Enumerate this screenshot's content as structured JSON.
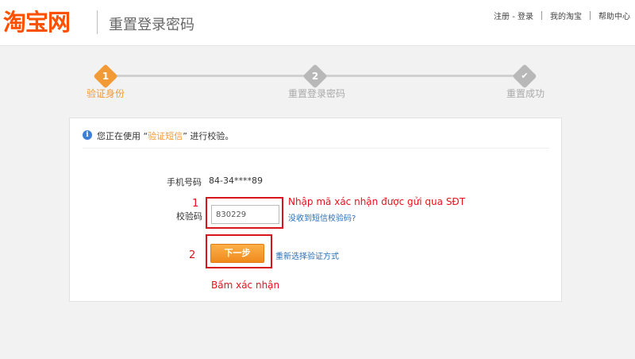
{
  "header": {
    "logo_text": "淘宝网",
    "page_title": "重置登录密码",
    "links": [
      "注册 - 登录",
      "我的淘宝",
      "帮助中心"
    ]
  },
  "steps": [
    {
      "number": "1",
      "label": "验证身份",
      "state": "active"
    },
    {
      "number": "2",
      "label": "重置登录密码",
      "state": "pending"
    },
    {
      "number": "✔",
      "label": "重置成功",
      "state": "pending"
    }
  ],
  "info": {
    "prefix": "您正在使用 “",
    "method": "验证短信",
    "suffix": "” 进行校验。"
  },
  "form": {
    "phone_label": "手机号码",
    "phone_value": "84-34****89",
    "code_label": "校验码",
    "code_value": "830229",
    "resend_link": "没收到短信校验码?",
    "next_button": "下一步",
    "other_method_link": "重新选择验证方式"
  },
  "annotations": {
    "num1": "1",
    "num2": "2",
    "text1": "Nhập mã xác nhận được gửi qua SĐT",
    "text2": "Bấm xác nhận"
  },
  "colors": {
    "brand": "#ff5000",
    "accent": "#f29a35",
    "link": "#2a6fb5",
    "annotation": "#e8101c"
  }
}
